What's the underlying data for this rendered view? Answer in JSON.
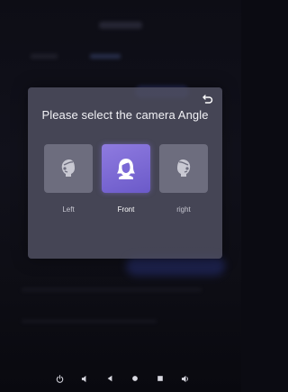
{
  "dialog": {
    "title": "Please select the camera Angle",
    "back_icon": "back-arrow-icon",
    "options": [
      {
        "label": "Left",
        "icon": "face-left-icon",
        "selected": false
      },
      {
        "label": "Front",
        "icon": "face-front-icon",
        "selected": true
      },
      {
        "label": "right",
        "icon": "face-right-icon",
        "selected": false
      }
    ]
  },
  "navbar": {
    "buttons": [
      {
        "icon": "power-icon"
      },
      {
        "icon": "volume-down-icon"
      },
      {
        "icon": "back-triangle-icon"
      },
      {
        "icon": "home-circle-icon"
      },
      {
        "icon": "recent-square-icon"
      },
      {
        "icon": "volume-up-icon"
      }
    ]
  },
  "colors": {
    "accent": "#7a68d6",
    "panel": "#4e4e60",
    "tile": "#6d6d7e",
    "background": "#0d0d15"
  }
}
